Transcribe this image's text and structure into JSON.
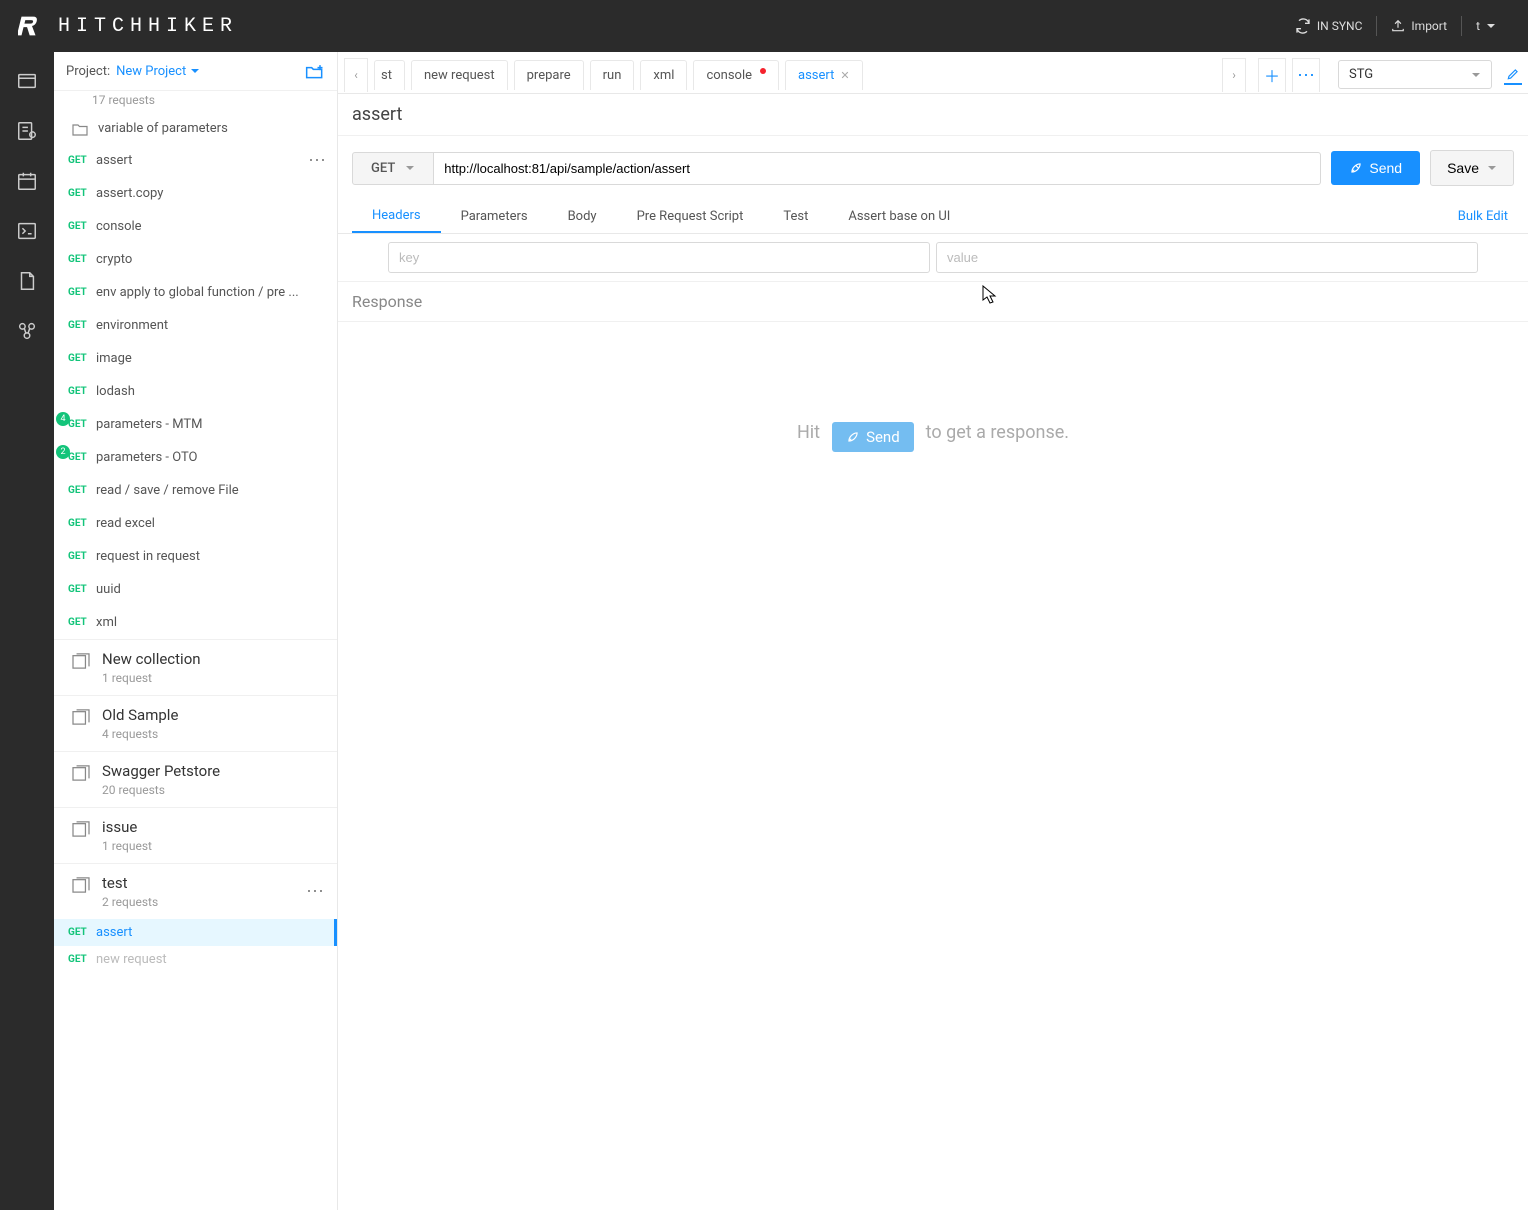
{
  "header": {
    "logo_text": "HITCHHIKER",
    "sync": "IN SYNC",
    "import": "Import",
    "user": "t"
  },
  "sidebar": {
    "project_label": "Project:",
    "project_name": "New Project",
    "requests_count": "17 requests",
    "folder_name": "variable of parameters",
    "items": [
      {
        "method": "GET",
        "name": "assert",
        "dots": true
      },
      {
        "method": "GET",
        "name": "assert.copy"
      },
      {
        "method": "GET",
        "name": "console"
      },
      {
        "method": "GET",
        "name": "crypto"
      },
      {
        "method": "GET",
        "name": "env apply to global function / pre ..."
      },
      {
        "method": "GET",
        "name": "environment"
      },
      {
        "method": "GET",
        "name": "image"
      },
      {
        "method": "GET",
        "name": "lodash"
      },
      {
        "method": "GET",
        "name": "parameters - MTM",
        "badge": "4"
      },
      {
        "method": "GET",
        "name": "parameters - OTO",
        "badge": "2"
      },
      {
        "method": "GET",
        "name": "read / save / remove File"
      },
      {
        "method": "GET",
        "name": "read excel"
      },
      {
        "method": "GET",
        "name": "request in request"
      },
      {
        "method": "GET",
        "name": "uuid"
      },
      {
        "method": "GET",
        "name": "xml"
      }
    ],
    "collections": [
      {
        "title": "New collection",
        "sub": "1 request"
      },
      {
        "title": "Old Sample",
        "sub": "4 requests"
      },
      {
        "title": "Swagger Petstore",
        "sub": "20 requests"
      },
      {
        "title": "issue",
        "sub": "1 request"
      },
      {
        "title": "test",
        "sub": "2 requests",
        "dots": true
      }
    ],
    "active_children": [
      {
        "method": "GET",
        "name": "assert",
        "active": true
      },
      {
        "method": "GET",
        "name": "new request",
        "faded": true
      }
    ]
  },
  "tabs": {
    "partial": "st",
    "list": [
      {
        "label": "new request"
      },
      {
        "label": "prepare"
      },
      {
        "label": "run"
      },
      {
        "label": "xml"
      },
      {
        "label": "console",
        "dot": true
      },
      {
        "label": "assert",
        "active": true,
        "close": true
      }
    ],
    "env": "STG"
  },
  "request": {
    "title": "assert",
    "method": "GET",
    "url": "http://localhost:81/api/sample/action/assert",
    "send": "Send",
    "save": "Save"
  },
  "subtabs": {
    "list": [
      "Headers",
      "Parameters",
      "Body",
      "Pre Request Script",
      "Test",
      "Assert base on UI"
    ],
    "active": "Headers",
    "bulk": "Bulk Edit",
    "key_ph": "key",
    "value_ph": "value"
  },
  "response": {
    "title": "Response",
    "hit": "Hit",
    "tail": "to get a response.",
    "send": "Send"
  }
}
